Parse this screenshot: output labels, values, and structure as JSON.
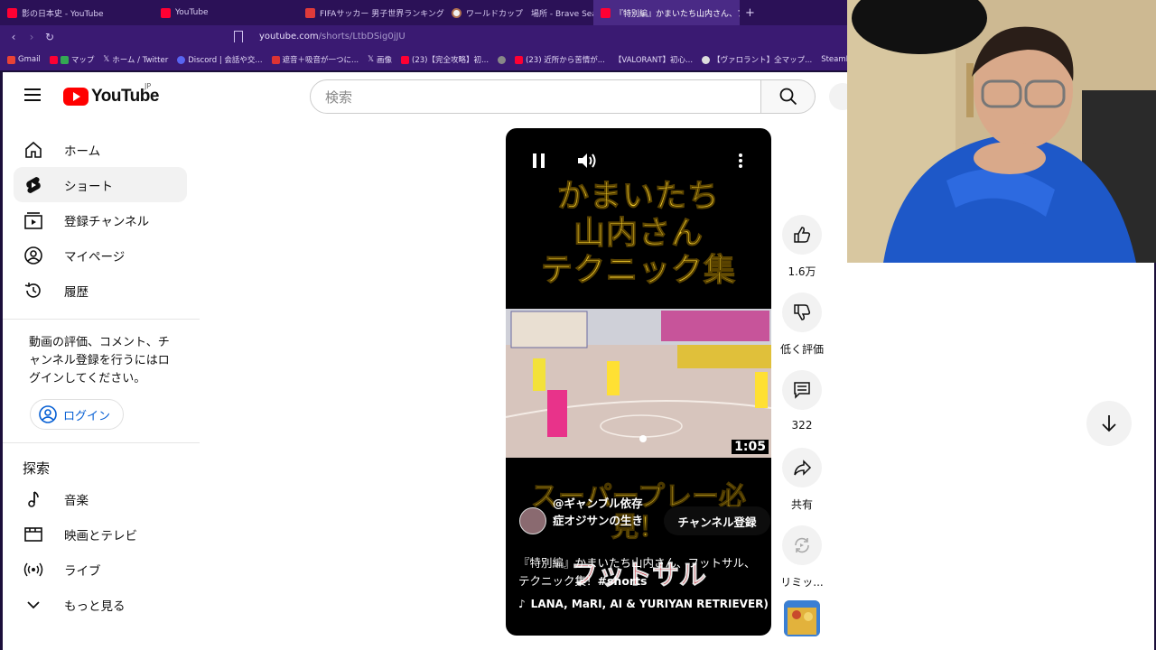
{
  "browser": {
    "tabs": [
      {
        "label": "影の日本史 - YouTube",
        "icon": "youtube-icon"
      },
      {
        "label": "YouTube",
        "icon": "youtube-icon"
      },
      {
        "label": "FIFAサッカー 男子世界ランキング | J SPO",
        "icon": "fifa-icon"
      },
      {
        "label": "ワールドカップ　場所 - Brave Search",
        "icon": "brave-icon"
      },
      {
        "label": "『特別編』かまいたち山内さん、フット",
        "icon": "youtube-icon",
        "active": true
      }
    ],
    "url": "youtube.com",
    "url_path": "/shorts/LtbDSig0jJU",
    "bookmarks": [
      "Gmail",
      "マップ",
      "ホーム / Twitter",
      "Discord | 会話や交...",
      "遮音＋吸音が一つに...",
      "画像",
      "(23)【完全攻略】初...",
      "(23) 近所から苦情が...",
      "【VALORANT】初心...",
      "【ヴァロラント】全マップ...",
      "SteamDB"
    ]
  },
  "youtube": {
    "logo_text": "YouTube",
    "region": "JP",
    "search_placeholder": "検索",
    "nav": [
      {
        "label": "ホーム",
        "icon": "home-icon"
      },
      {
        "label": "ショート",
        "icon": "shorts-icon",
        "active": true
      },
      {
        "label": "登録チャンネル",
        "icon": "subscriptions-icon"
      },
      {
        "label": "マイページ",
        "icon": "account-icon"
      },
      {
        "label": "履歴",
        "icon": "history-icon"
      }
    ],
    "signin_prompt": "動画の評価、コメント、チャンネル登録を行うにはログインしてください。",
    "login_label": "ログイン",
    "explore_title": "探索",
    "explore": [
      {
        "label": "音楽",
        "icon": "music-icon"
      },
      {
        "label": "映画とテレビ",
        "icon": "film-icon"
      },
      {
        "label": "ライブ",
        "icon": "live-icon"
      },
      {
        "label": "もっと見る",
        "icon": "chevron-down-icon"
      }
    ]
  },
  "short": {
    "overlay_title": [
      "かまいたち",
      "山内さん",
      "テクニック集"
    ],
    "timecode": "1:05",
    "overlay_bottom": "スーパープレー必見！",
    "overlay_red": "フットサル",
    "channel_name": "@ギャンブル依存症オジサンの生き",
    "subscribe_label": "チャンネル登録",
    "video_title": "『特別編』かまいたち山内さん、フットサル、テクニック集！",
    "hashtag": "#shorts",
    "music": "LANA, MaRI, AI & YURIYAN RETRIEVER)"
  },
  "actions": {
    "likes": "1.6万",
    "dislike_label": "低く評価",
    "comments": "322",
    "share_label": "共有",
    "remix_label": "リミッ..."
  },
  "colors": {
    "youtube_red": "#ff0000",
    "browser_purple": "#3a1a72",
    "overlay_yellow": "#f5cf2e"
  }
}
